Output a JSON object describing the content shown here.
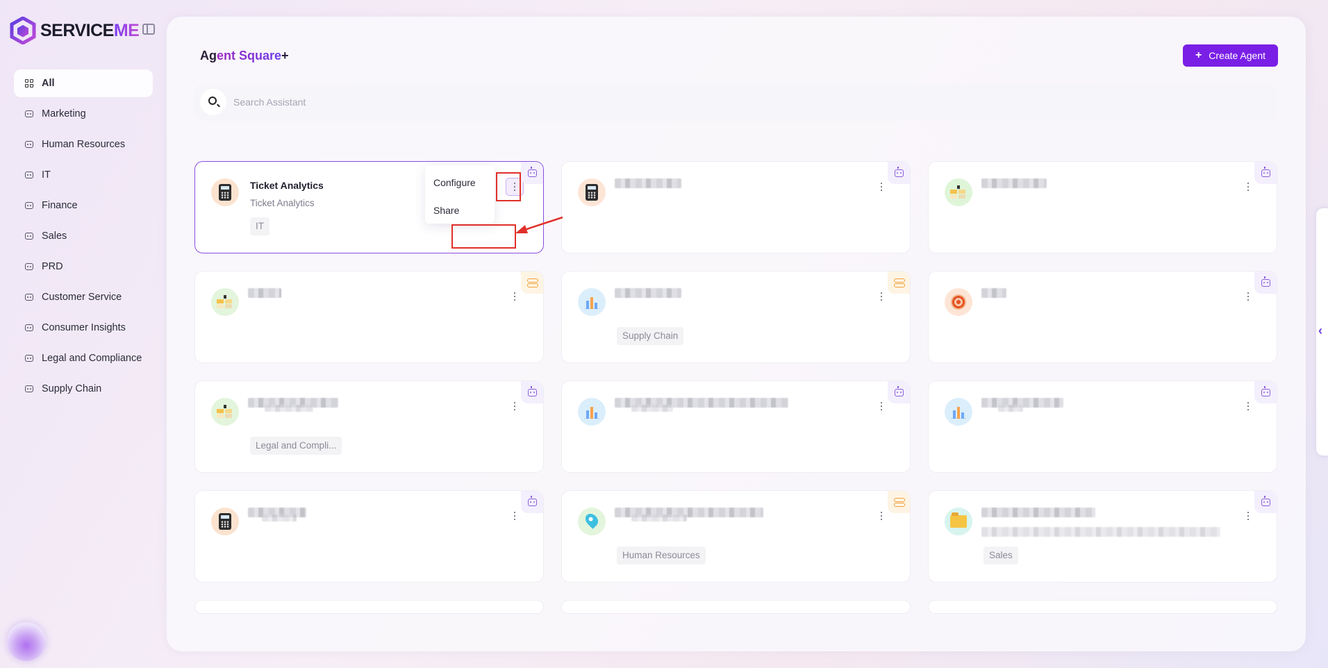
{
  "brand": {
    "name_part1": "SERVICE",
    "name_part2": "ME"
  },
  "sidebar": {
    "items": [
      {
        "label": "All",
        "icon": "grid-icon",
        "active": true
      },
      {
        "label": "Marketing",
        "icon": "robot-icon"
      },
      {
        "label": "Human Resources",
        "icon": "robot-icon"
      },
      {
        "label": "IT",
        "icon": "robot-icon"
      },
      {
        "label": "Finance",
        "icon": "robot-icon"
      },
      {
        "label": "Sales",
        "icon": "robot-icon"
      },
      {
        "label": "PRD",
        "icon": "robot-icon"
      },
      {
        "label": "Customer Service",
        "icon": "robot-icon"
      },
      {
        "label": "Consumer Insights",
        "icon": "robot-icon"
      },
      {
        "label": "Legal and Compliance",
        "icon": "robot-icon"
      },
      {
        "label": "Supply Chain",
        "icon": "robot-icon"
      }
    ]
  },
  "header": {
    "title_part1": "Ag",
    "title_part2": "ent Square",
    "title_part3": "+",
    "create_label": "Create Agent",
    "create_icon": "+"
  },
  "search": {
    "placeholder": "Search Assistant"
  },
  "cards": [
    {
      "title": "Ticket Analytics",
      "subtitle": "Ticket Analytics",
      "tag": "IT",
      "icon": "calculator-icon",
      "badge": "robot"
    },
    {
      "title": "",
      "tag": "",
      "icon": "calculator-icon",
      "badge": "robot"
    },
    {
      "title": "",
      "tag": "",
      "icon": "blocks-icon",
      "badge": "robot"
    },
    {
      "title": "",
      "tag": "",
      "icon": "blocks-icon",
      "badge": "workflow"
    },
    {
      "title": "",
      "tag": "Supply Chain",
      "icon": "bar-chart-icon",
      "badge": "workflow"
    },
    {
      "title": "",
      "tag": "",
      "icon": "target-icon",
      "badge": "robot"
    },
    {
      "title": "",
      "tag": "Legal and Compli...",
      "icon": "blocks-icon",
      "badge": "robot"
    },
    {
      "title": "",
      "tag": "",
      "icon": "bar-chart-icon",
      "badge": "robot"
    },
    {
      "title": "",
      "tag": "",
      "icon": "bar-chart-icon",
      "badge": "robot"
    },
    {
      "title": "",
      "tag": "",
      "icon": "calculator-icon",
      "badge": "robot"
    },
    {
      "title": "",
      "tag": "Human Resources",
      "icon": "map-pin-icon",
      "badge": "workflow"
    },
    {
      "title": "",
      "tag": "Sales",
      "icon": "folder-icon",
      "badge": "robot"
    }
  ],
  "menu": {
    "items": [
      "Configure",
      "Share"
    ]
  },
  "colors": {
    "accent": "#7a1fe6",
    "highlight": "#e0302a"
  }
}
